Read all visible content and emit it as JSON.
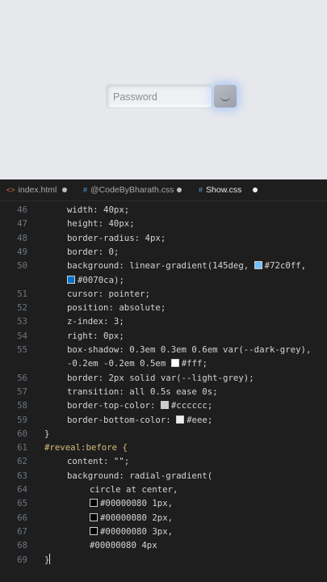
{
  "preview": {
    "password_placeholder": "Password"
  },
  "tabs": [
    {
      "icon": "<>",
      "label": "index.html"
    },
    {
      "icon": "#",
      "label": "@CodeByBharath.css"
    },
    {
      "icon": "#",
      "label": "Show.css"
    }
  ],
  "colors": {
    "accent": "#72c0ff",
    "accent2": "#0070ca",
    "editor_bg": "#1e1e1e"
  },
  "lines": [
    {
      "n": "46",
      "text": "width: 40px;"
    },
    {
      "n": "47",
      "text": "height: 40px;"
    },
    {
      "n": "48",
      "text": "border-radius: 4px;"
    },
    {
      "n": "49",
      "text": "border: 0;"
    },
    {
      "n": "50",
      "text": "background: linear-gradient(145deg, ",
      "sw": "#72c0ff",
      "after": "#72c0ff,"
    },
    {
      "n": "",
      "text": "",
      "sw": "#0070ca",
      "after": "#0070ca);"
    },
    {
      "n": "51",
      "text": "cursor: pointer;"
    },
    {
      "n": "52",
      "text": "position: absolute;"
    },
    {
      "n": "53",
      "text": "z-index: 3;"
    },
    {
      "n": "54",
      "text": "right: 0px;"
    },
    {
      "n": "55",
      "text": "box-shadow: 0.3em 0.3em 0.6em var(--dark-grey),"
    },
    {
      "n": "",
      "text": "-0.2em -0.2em 0.5em ",
      "sw": "#ffffff",
      "after": "#fff;"
    },
    {
      "n": "56",
      "text": "border: 2px solid var(--light-grey);"
    },
    {
      "n": "57",
      "text": "transition: all 0.5s ease 0s;"
    },
    {
      "n": "58",
      "text": "border-top-color: ",
      "sw": "#cccccc",
      "after": "#cccccc;"
    },
    {
      "n": "59",
      "text": "border-bottom-color: ",
      "sw": "#eeeeee",
      "after": "#eee;"
    },
    {
      "n": "60",
      "text": "}"
    },
    {
      "n": "61",
      "text": "#reveal:before {"
    },
    {
      "n": "62",
      "text": "content: \"\";"
    },
    {
      "n": "63",
      "text": "background: radial-gradient("
    },
    {
      "n": "64",
      "text": "circle at center,"
    },
    {
      "n": "65",
      "text": "",
      "sw": "#000000",
      "after": "#00000080 1px,"
    },
    {
      "n": "66",
      "text": "",
      "sw": "#000000",
      "after": "#00000080 2px,"
    },
    {
      "n": "67",
      "text": "",
      "sw": "#000000",
      "after": "#00000080 3px,"
    },
    {
      "n": "68",
      "text": "#00000080 4px"
    },
    {
      "n": "69",
      "text": "}"
    }
  ]
}
